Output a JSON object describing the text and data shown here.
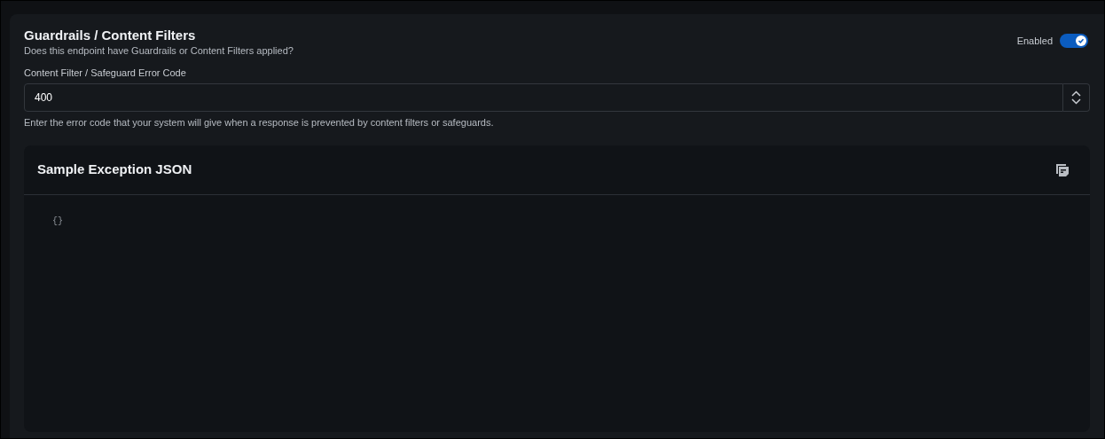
{
  "section": {
    "title": "Guardrails / Content Filters",
    "description": "Does this endpoint have Guardrails or Content Filters applied?",
    "toggle": {
      "label": "Enabled",
      "on": true
    }
  },
  "error_code": {
    "label": "Content Filter / Safeguard Error Code",
    "value": "400",
    "help": "Enter the error code that your system will give when a response is prevented by content filters or safeguards."
  },
  "sample": {
    "title": "Sample Exception JSON",
    "code": "{}"
  }
}
